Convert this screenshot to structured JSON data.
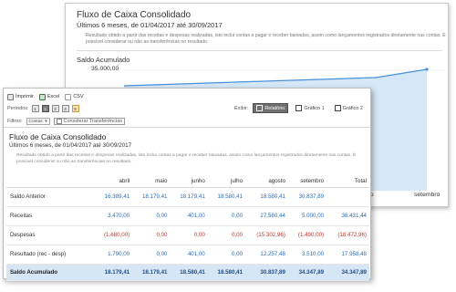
{
  "back_panel": {
    "title": "Fluxo de Caixa Consolidado",
    "subtitle": "Últimos 6 meses, de 01/04/2017 até 30/09/2017",
    "description": "Resultado obtido a partir das receitas e despesas realizadas, isto inclui contas a pagar e receber baixadas, assim como lançamentos registrados diretamente nas contas. É possível considerar ou não as transferências no resultado.",
    "series_label": "Saldo Acumulado",
    "y_tick": "35.000,00",
    "x_labels": [
      "to",
      "setembro"
    ],
    "chart_color": "#4a90d9",
    "chart_fill": "#d6e8f7"
  },
  "toolbar": {
    "print_label": "Imprimir",
    "excel_label": "Excel",
    "csv_label": "CSV"
  },
  "periods": {
    "label": "Períodos:",
    "buttons": [
      "1",
      "2",
      "3",
      "4",
      "5"
    ]
  },
  "exibir": {
    "label": "Exibir:",
    "options": [
      "Relatório",
      "Gráfico 1",
      "Gráfico 2"
    ],
    "active": "Relatório"
  },
  "filters": {
    "label": "Filtros:",
    "contas_value": "Contas",
    "consider_transfers_label": "Considerar Transferências"
  },
  "report": {
    "title": "Fluxo de Caixa Consolidado",
    "subtitle": "Últimos 6 meses, de 01/04/2017 até 30/09/2017",
    "description": "Resultado obtido a partir das receitas e despesas realizadas, isto inclui contas a pagar e receber baixadas, assim como lançamentos registrados diretamente nas contas. É possível considerar ou não as transferências no resultado."
  },
  "table": {
    "columns": [
      "",
      "abril",
      "maio",
      "junho",
      "julho",
      "agosto",
      "setembro",
      "Total"
    ],
    "rows": [
      {
        "label": "Saldo Anterior",
        "values": [
          "16.389,41",
          "18.179,41",
          "18.179,41",
          "18.580,41",
          "18.580,41",
          "30.837,89",
          ""
        ],
        "kind": "normal"
      },
      {
        "label": "Receitas",
        "values": [
          "3.470,00",
          "0,00",
          "401,00",
          "0,00",
          "27.560,44",
          "5.000,00",
          "36.431,44"
        ],
        "kind": "normal"
      },
      {
        "label": "Despesas",
        "values": [
          "(1.680,00)",
          "0,00",
          "0,00",
          "0,00",
          "(15.302,96)",
          "(1.490,00)",
          "(18.472,96)"
        ],
        "kind": "neg"
      },
      {
        "label": "Resultado (rec - desp)",
        "values": [
          "1.790,00",
          "0,00",
          "401,00",
          "0,00",
          "12.257,48",
          "3.510,00",
          "17.958,48"
        ],
        "kind": "normal"
      },
      {
        "label": "Saldo Acumulado",
        "values": [
          "18.179,41",
          "18.179,41",
          "18.580,41",
          "18.580,41",
          "30.837,89",
          "34.347,89",
          "34.347,89"
        ],
        "kind": "total"
      }
    ]
  }
}
